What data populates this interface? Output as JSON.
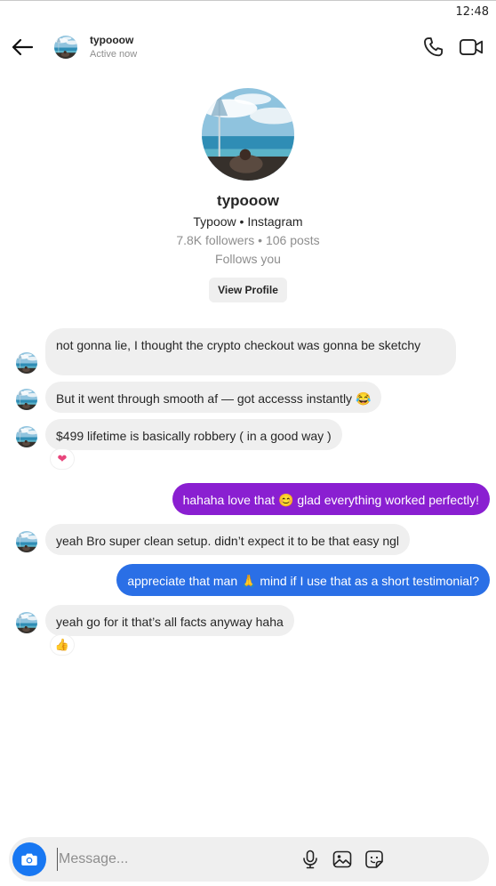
{
  "status_bar": {
    "time": "12:48"
  },
  "header": {
    "username": "typooow",
    "status": "Active now"
  },
  "profile": {
    "username": "typooow",
    "line": "Typoow • Instagram",
    "stats": "7.8K followers • 106 posts",
    "follows": "Follows you",
    "view_profile_label": "View Profile"
  },
  "messages": [
    {
      "from": "them",
      "text": "not gonna lie, I thought the crypto checkout was gonna be sketchy"
    },
    {
      "from": "them",
      "text": "But it went through smooth af — got accesss instantly 😂"
    },
    {
      "from": "them",
      "text": "$499 lifetime is basically robbery ( in a good way )",
      "reaction": "❤"
    },
    {
      "from": "me",
      "text": "hahaha love that 😊 glad everything worked perfectly!",
      "color": "#8a1fd1"
    },
    {
      "from": "them",
      "text": "yeah Bro super clean setup. didn’t expect it to be that easy ngl"
    },
    {
      "from": "me",
      "text": "appreciate that man 🙏 mind if I use that as a short testimonial?",
      "color": "#2a6fe6"
    },
    {
      "from": "them",
      "text": "yeah go for it  that’s all facts anyway haha",
      "reaction": "👍"
    }
  ],
  "composer": {
    "placeholder": "Message..."
  },
  "colors": {
    "accent_blue": "#1877f2",
    "outgoing_purple": "#8a1fd1",
    "outgoing_blue": "#2a6fe6",
    "incoming_gray": "#efefef"
  },
  "icons": [
    "back-arrow-icon",
    "phone-icon",
    "video-camera-icon",
    "camera-icon",
    "microphone-icon",
    "gallery-icon",
    "sticker-icon"
  ]
}
